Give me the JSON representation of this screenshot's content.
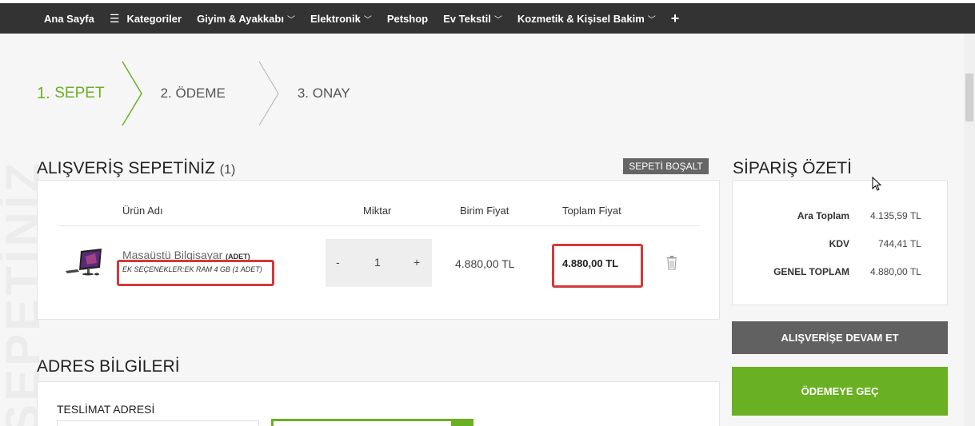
{
  "nav": {
    "items": [
      {
        "label": "Ana Sayfa",
        "icon": "",
        "dropdown": false
      },
      {
        "label": "Kategoriler",
        "icon": "menu-icon",
        "dropdown": false
      },
      {
        "label": "Giyim & Ayakkabı",
        "icon": "",
        "dropdown": true
      },
      {
        "label": "Elektronik",
        "icon": "",
        "dropdown": true
      },
      {
        "label": "Petshop",
        "icon": "",
        "dropdown": false
      },
      {
        "label": "Ev Tekstil",
        "icon": "",
        "dropdown": true
      },
      {
        "label": "Kozmetik & Kişisel Bakim",
        "icon": "",
        "dropdown": true
      }
    ],
    "plus_label": "+"
  },
  "steps": [
    {
      "num": "1.",
      "label": "SEPET",
      "active": true
    },
    {
      "num": "2.",
      "label": "ÖDEME",
      "active": false
    },
    {
      "num": "3.",
      "label": "ONAY",
      "active": false
    }
  ],
  "watermark": "SEPETİNİZ",
  "cart": {
    "title": "ALIŞVERİŞ SEPETİNİZ",
    "count": "(1)",
    "empty_button": "SEPETİ BOŞALT",
    "columns": {
      "product": "Ürün Adı",
      "quantity": "Miktar",
      "unit_price": "Birim Fiyat",
      "total_price": "Toplam Fiyat"
    },
    "items": [
      {
        "name": "Masaüstü Bilgisayar",
        "unit": "(ADET)",
        "options": "EK SEÇENEKLER:EK RAM 4 GB (1 ADET)",
        "qty_minus": "-",
        "quantity": "1",
        "qty_plus": "+",
        "unit_price": "4.880,00 TL",
        "total_price": "4.880,00 TL"
      }
    ]
  },
  "address": {
    "title": "ADRES BİLGİLERİ",
    "delivery_label": "TESLİMAT ADRESİ"
  },
  "summary": {
    "title": "SİPARİŞ ÖZETİ",
    "rows": [
      {
        "label": "Ara Toplam",
        "value": "4.135,59 TL"
      },
      {
        "label": "KDV",
        "value": "744,41 TL"
      },
      {
        "label": "GENEL TOPLAM",
        "value": "4.880,00 TL"
      }
    ],
    "continue_button": "ALIŞVERİŞE DEVAM ET",
    "pay_button": "ÖDEMEYE GEÇ"
  },
  "colors": {
    "accent": "#6ab023",
    "topbar": "#333333",
    "highlight": "#d6383a",
    "button_dark": "#616161"
  }
}
